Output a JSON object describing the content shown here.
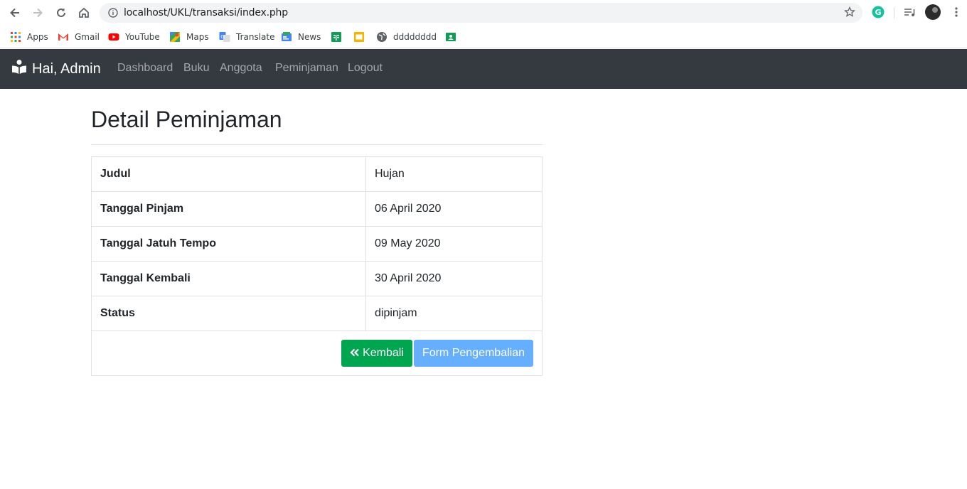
{
  "browser": {
    "url": "localhost/UKL/transaksi/index.php",
    "bookmarks": [
      {
        "label": "Apps",
        "icon": "apps-grid-icon"
      },
      {
        "label": "Gmail",
        "icon": "gmail-icon"
      },
      {
        "label": "YouTube",
        "icon": "youtube-icon"
      },
      {
        "label": "Maps",
        "icon": "maps-icon"
      },
      {
        "label": "Translate",
        "icon": "translate-icon"
      },
      {
        "label": "News",
        "icon": "news-icon"
      },
      {
        "label": "",
        "icon": "sheets-icon"
      },
      {
        "label": "",
        "icon": "slides-icon"
      },
      {
        "label": "dddddddd",
        "icon": "globe-icon"
      },
      {
        "label": "",
        "icon": "classroom-icon"
      }
    ]
  },
  "navbar": {
    "brand": "Hai, Admin",
    "links": [
      "Dashboard",
      "Buku",
      "Anggota",
      "Peminjaman",
      "Logout"
    ]
  },
  "page": {
    "title": "Detail Peminjaman",
    "rows": [
      {
        "label": "Judul",
        "value": "Hujan"
      },
      {
        "label": "Tanggal Pinjam",
        "value": "06 April 2020"
      },
      {
        "label": "Tanggal Jatuh Tempo",
        "value": "09 May 2020"
      },
      {
        "label": "Tanggal Kembali",
        "value": "30 April 2020"
      },
      {
        "label": "Status",
        "value": "dipinjam"
      }
    ],
    "back_button": "Kembali",
    "form_button": "Form Pengembalian"
  },
  "colors": {
    "navbar": "#343a40",
    "success": "#00a550",
    "primary_disabled": "#66afff"
  }
}
